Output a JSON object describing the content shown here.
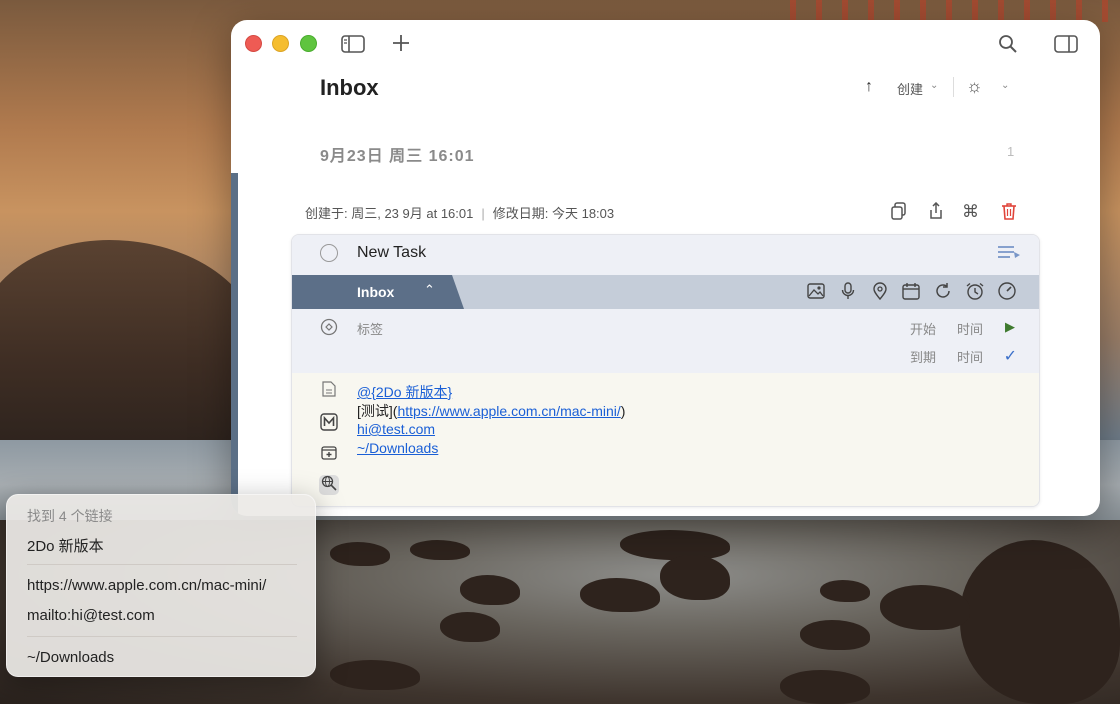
{
  "toolbar": {
    "sidebar_icon": "sidebar-icon",
    "add_icon": "plus-icon",
    "search_icon": "search-icon",
    "inspector_icon": "inspector-icon"
  },
  "header": {
    "title": "Inbox",
    "sort_direction": "↑",
    "sort_label": "创建",
    "chevron": "⌄",
    "view_icon": "☼"
  },
  "date_section": {
    "date": "9月23日 周三 16:01",
    "count": "1"
  },
  "meta": {
    "created": "创建于:  周三, 23 9月 at 16:01",
    "separator": "|",
    "modified": "修改日期:  今天 18:03"
  },
  "task": {
    "title": "New Task",
    "list": "Inbox",
    "tags_label": "标签",
    "start_label": "开始",
    "start_time": "时间",
    "due_label": "到期",
    "due_time": "时间",
    "note_line1": "@{2Do 新版本}",
    "note_line2_prefix": "[测试](",
    "note_line2_link": "https://www.apple.com.cn/mac-mini/",
    "note_line2_suffix": ")",
    "note_line3": "hi@test.com",
    "note_line4": "~/Downloads"
  },
  "popover": {
    "header": "找到 4 个链接",
    "items": [
      "2Do 新版本",
      "https://www.apple.com.cn/mac-mini/",
      "mailto:hi@test.com",
      "~/Downloads"
    ]
  },
  "colors": {
    "accent": "#5c6f88",
    "link": "#1a5fd6",
    "delete": "#e0443a",
    "play": "#3e7a2e"
  }
}
